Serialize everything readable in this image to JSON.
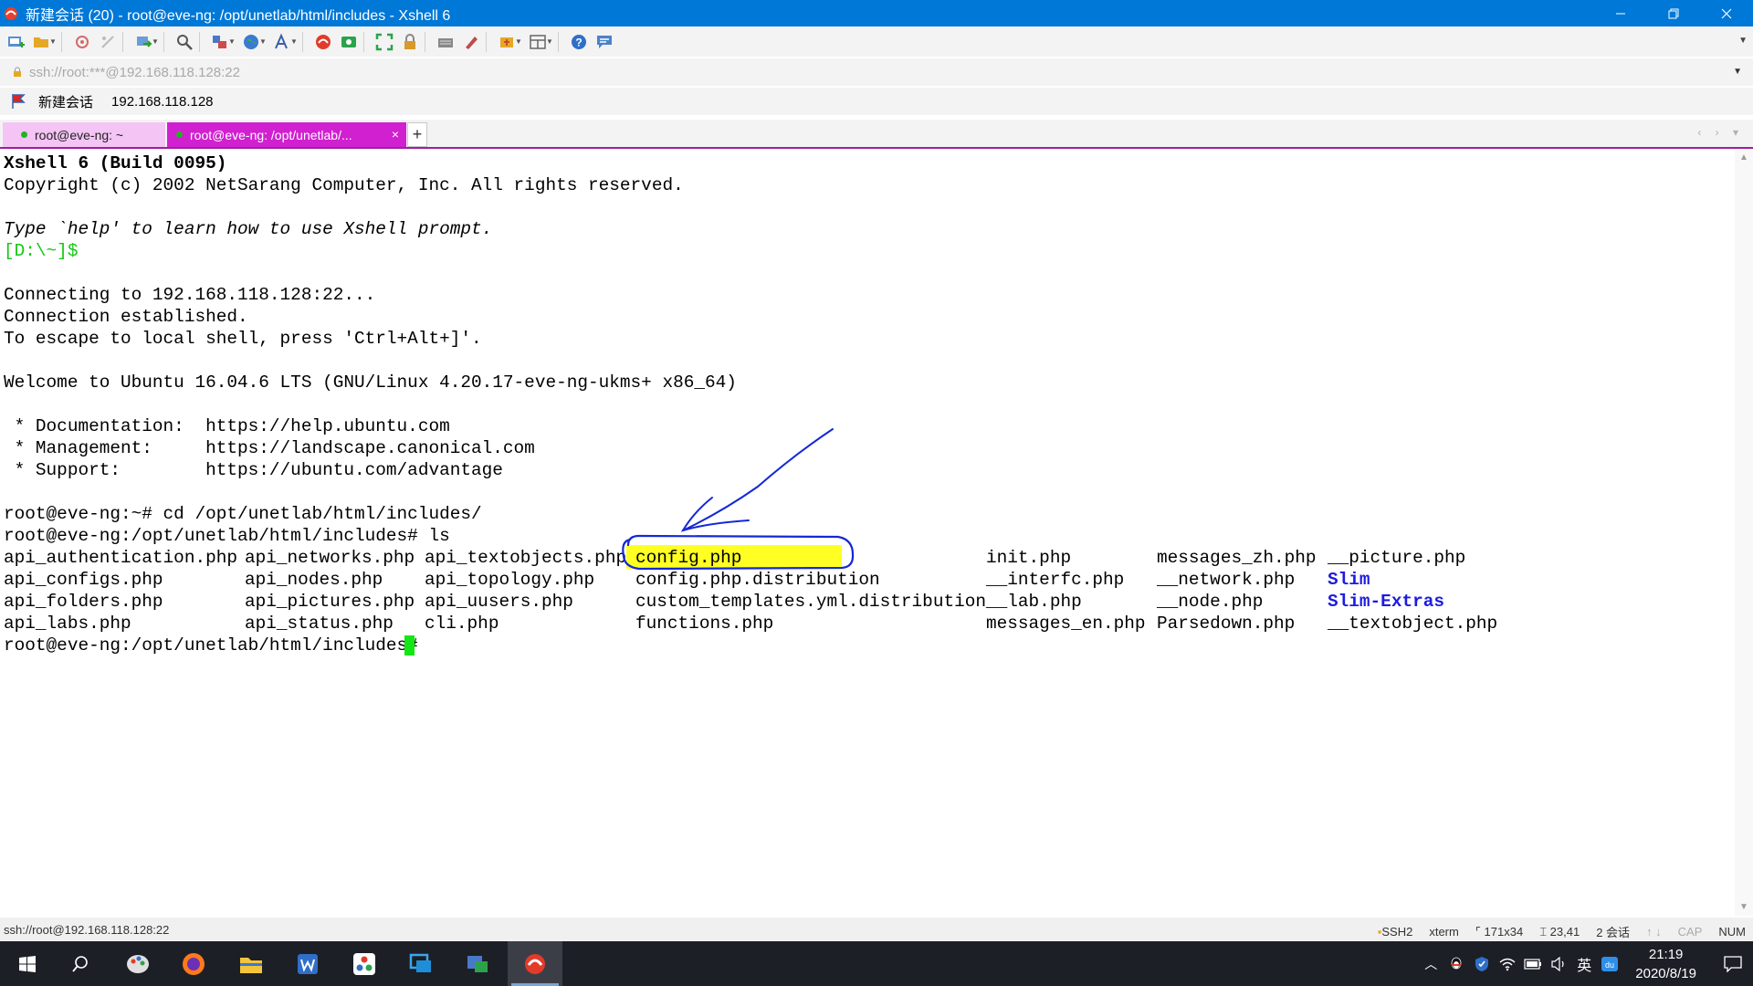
{
  "window": {
    "title": "新建会话 (20) - root@eve-ng: /opt/unetlab/html/includes - Xshell 6"
  },
  "address": {
    "text": "ssh://root:***@192.168.118.128:22"
  },
  "session": {
    "name": "新建会话",
    "host": "192.168.118.128"
  },
  "tabs": [
    {
      "label": "root@eve-ng: ~",
      "active": false
    },
    {
      "label": "root@eve-ng: /opt/unetlab/...",
      "active": true
    }
  ],
  "terminal": {
    "banner_line1": "Xshell 6 (Build 0095)",
    "banner_line2": "Copyright (c) 2002 NetSarang Computer, Inc. All rights reserved.",
    "help_line": "Type `help' to learn how to use Xshell prompt.",
    "local_prompt": "[D:\\~]$",
    "connecting": "Connecting to 192.168.118.128:22...",
    "established": "Connection established.",
    "escape": "To escape to local shell, press 'Ctrl+Alt+]'.",
    "welcome": "Welcome to Ubuntu 16.04.6 LTS (GNU/Linux 4.20.17-eve-ng-ukms+ x86_64)",
    "doc_line": " * Documentation:  https://help.ubuntu.com",
    "mgmt_line": " * Management:     https://landscape.canonical.com",
    "support_line": " * Support:        https://ubuntu.com/advantage",
    "cmd_cd": "root@eve-ng:~# cd /opt/unetlab/html/includes/",
    "cmd_ls": "root@eve-ng:/opt/unetlab/html/includes# ls",
    "final_prompt": "root@eve-ng:/opt/unetlab/html/includes# ",
    "ls_columns": [
      [
        "api_authentication.php",
        "api_configs.php",
        "api_folders.php",
        "api_labs.php"
      ],
      [
        "api_networks.php",
        "api_nodes.php",
        "api_pictures.php",
        "api_status.php"
      ],
      [
        "api_textobjects.php",
        "api_topology.php",
        "api_uusers.php",
        "cli.php"
      ],
      [
        "config.php",
        "config.php.distribution",
        "custom_templates.yml.distribution",
        "functions.php"
      ],
      [
        "init.php",
        "__interfc.php",
        "__lab.php",
        "messages_en.php"
      ],
      [
        "messages_zh.php",
        "__network.php",
        "__node.php",
        "Parsedown.php"
      ],
      [
        "__picture.php",
        "Slim",
        "Slim-Extras",
        "__textobject.php"
      ]
    ],
    "directories": [
      "Slim",
      "Slim-Extras"
    ],
    "highlighted_file": "config.php",
    "colors": {
      "prompt_green": "#14c814",
      "dir_blue": "#1c1ce0",
      "highlight_yellow": "#ffff24",
      "annotation_blue": "#1428d8",
      "cursor_green": "#14e614"
    }
  },
  "statusbar": {
    "connection": "ssh://root@192.168.118.128:22",
    "protocol": "SSH2",
    "terminal_type": "xterm",
    "size": "171x34",
    "cursor_pos": "23,41",
    "sessions": "2 会话",
    "cap": "CAP",
    "num": "NUM"
  },
  "taskbar": {
    "time": "21:19",
    "date": "2020/8/19",
    "ime": "英"
  }
}
